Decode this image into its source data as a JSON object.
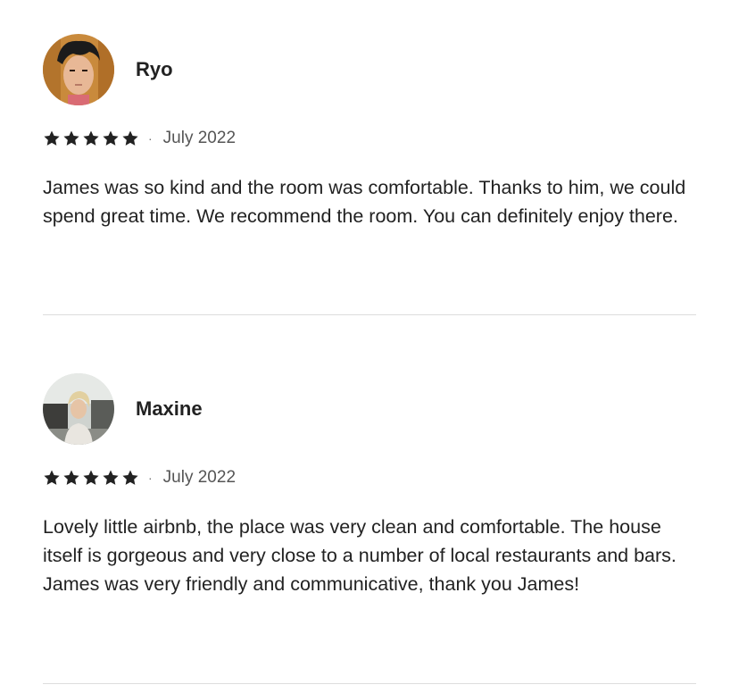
{
  "reviews": [
    {
      "name": "Ryo",
      "rating": 5,
      "separator": "·",
      "date": "July 2022",
      "text": "James was so kind and the room was comfortable. Thanks to him, we could spend great time. We recommend the room. You can definitely enjoy there."
    },
    {
      "name": "Maxine",
      "rating": 5,
      "separator": "·",
      "date": "July 2022",
      "text": "Lovely little airbnb, the place was very clean and comfortable. The house itself is gorgeous and very close to a number of local restaurants and bars. James was very friendly and communicative, thank you James!"
    }
  ],
  "colors": {
    "text": "#222222",
    "muted": "#717171",
    "divider": "#dddddd"
  }
}
